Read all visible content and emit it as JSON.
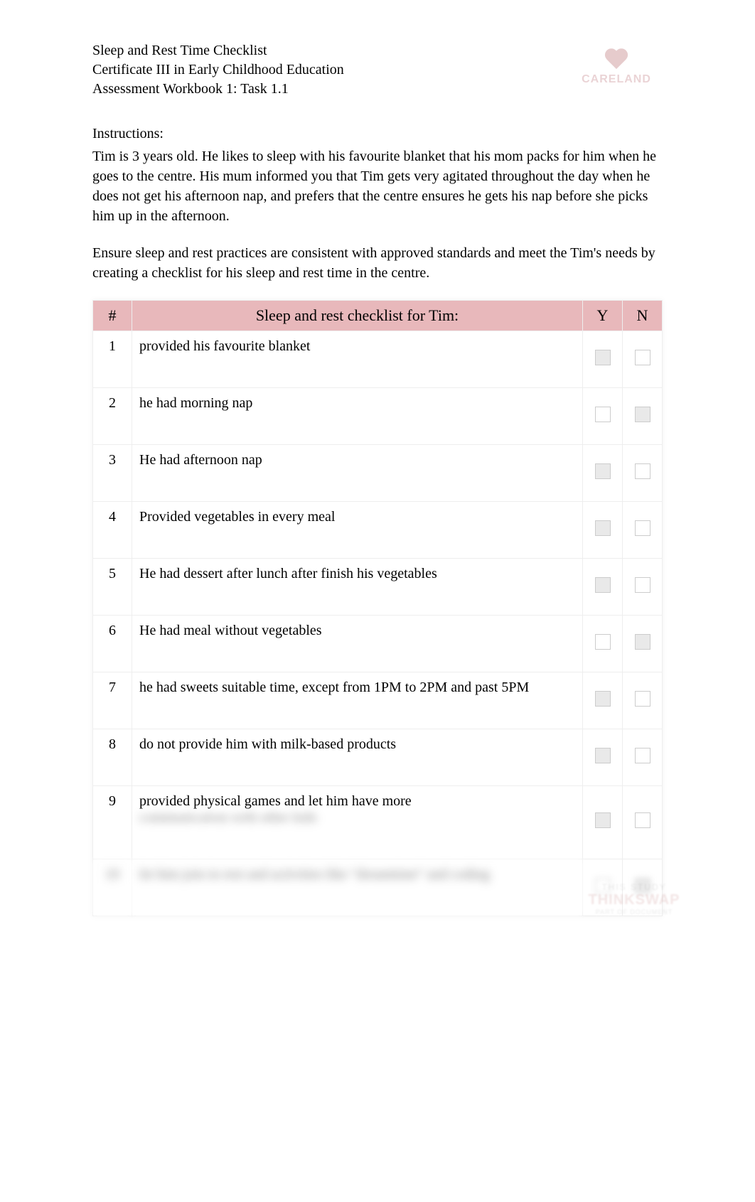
{
  "header": {
    "title": "Sleep and Rest Time Checklist",
    "subtitle1": "Certificate III in Early Childhood Education",
    "subtitle2": "Assessment Workbook 1: Task 1.1",
    "logo_text": "CARELAND"
  },
  "instructions": {
    "label": "Instructions:",
    "paragraph1": "Tim is 3 years old. He likes to sleep with his favourite blanket that his mom packs for him when he goes to the centre. His mum informed you that Tim gets very agitated throughout the day when he does not get his afternoon nap, and prefers that the centre ensures he gets his nap before she picks him up in the afternoon.",
    "paragraph2": "Ensure sleep and rest practices are consistent with approved standards and meet the Tim's needs by creating a checklist for his sleep and rest time in the centre."
  },
  "table": {
    "headers": {
      "num": "#",
      "item": "Sleep and rest checklist for Tim:",
      "y": "Y",
      "n": "N"
    },
    "rows": [
      {
        "num": "1",
        "item": "provided his favourite blanket",
        "y": true,
        "n": false,
        "blurred": false
      },
      {
        "num": "2",
        "item": "he had morning nap",
        "y": false,
        "n": true,
        "blurred": false
      },
      {
        "num": "3",
        "item": "He had afternoon nap",
        "y": true,
        "n": false,
        "blurred": false
      },
      {
        "num": "4",
        "item": "Provided vegetables in every meal",
        "y": true,
        "n": false,
        "blurred": false
      },
      {
        "num": "5",
        "item": "He had dessert after lunch after finish his vegetables",
        "y": true,
        "n": false,
        "blurred": false
      },
      {
        "num": "6",
        "item": "He had meal without vegetables",
        "y": false,
        "n": true,
        "blurred": false
      },
      {
        "num": "7",
        "item": "he had sweets suitable time, except from 1PM to 2PM and past 5PM",
        "y": true,
        "n": false,
        "blurred": false
      },
      {
        "num": "8",
        "item": "do not provide him with milk-based products",
        "y": true,
        "n": false,
        "blurred": false
      },
      {
        "num": "9",
        "item_line1": "provided physical games and let him have more",
        "item_line2": "communication with other kids",
        "y": true,
        "n": false,
        "partial_blur": true
      },
      {
        "num": "10",
        "item": "let him join in rest and activities like \"dreamtime\" and coding",
        "y": false,
        "n": true,
        "blurred": true
      }
    ]
  },
  "footer_logo": {
    "line1": "THIS STUDY",
    "line2": "THINKSWAP",
    "line3": "PART OF DOCUMENT"
  }
}
